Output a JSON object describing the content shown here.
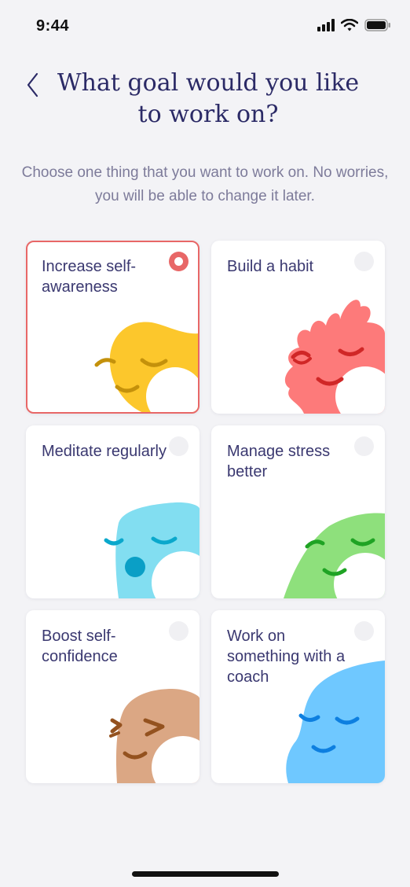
{
  "status": {
    "time": "9:44",
    "icons": [
      "signal-icon",
      "wifi-icon",
      "battery-icon"
    ]
  },
  "header": {
    "title": "What goal would you like to work on?",
    "back_icon": "chevron-left-icon"
  },
  "subtitle": "Choose one thing that you want to work on. No worries, you will be able to change it later.",
  "goals": [
    {
      "label": "Increase self-awareness",
      "selected": true,
      "color": "#fcc72c"
    },
    {
      "label": "Build a habit",
      "selected": false,
      "color": "#fd7a7a"
    },
    {
      "label": "Meditate regularly",
      "selected": false,
      "color": "#82def1"
    },
    {
      "label": "Manage stress better",
      "selected": false,
      "color": "#8ee07c"
    },
    {
      "label": "Boost self-confidence",
      "selected": false,
      "color": "#dba784"
    },
    {
      "label": "Work on something with a coach",
      "selected": false,
      "color": "#6fc8ff"
    }
  ],
  "colors": {
    "accent": "#e86767",
    "title": "#2b2a66",
    "background": "#f3f3f6"
  }
}
